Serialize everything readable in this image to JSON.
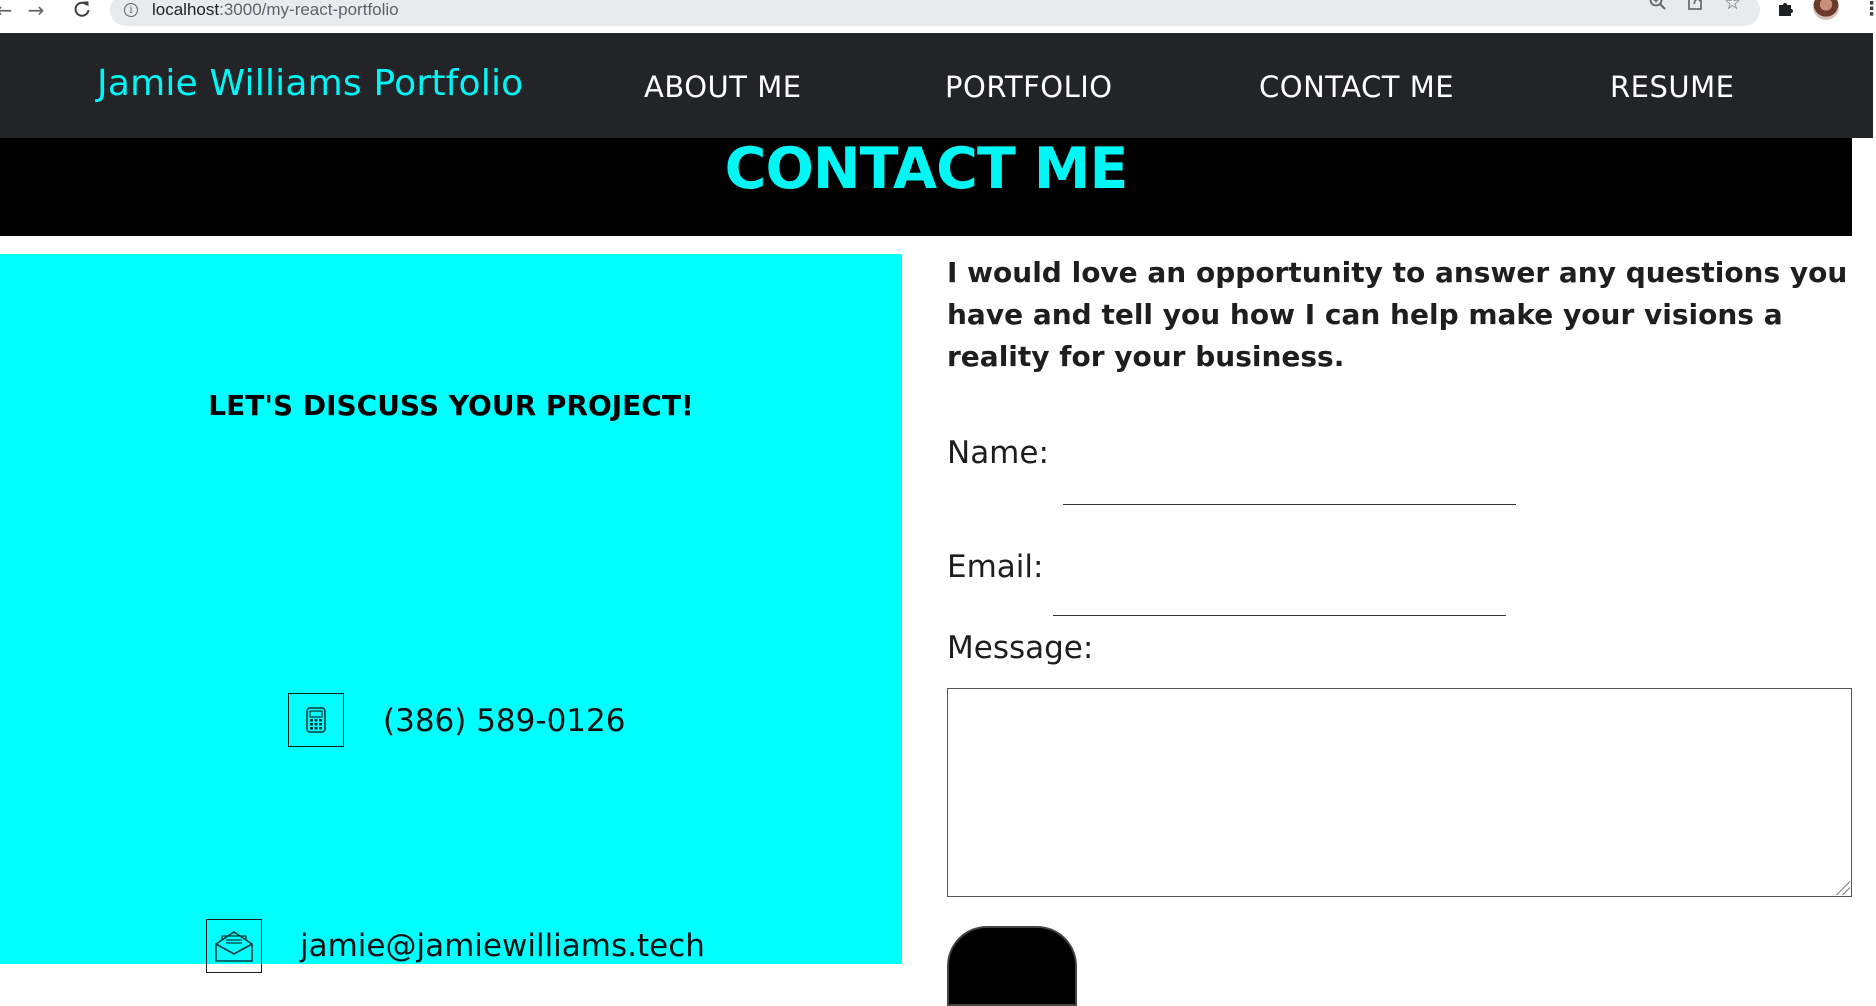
{
  "browser": {
    "url_host": "localhost",
    "url_path": ":3000/my-react-portfolio"
  },
  "header": {
    "brand": "Jamie Williams Portfolio",
    "nav": [
      {
        "label": "ABOUT ME"
      },
      {
        "label": "PORTFOLIO"
      },
      {
        "label": "CONTACT ME"
      },
      {
        "label": "RESUME"
      }
    ]
  },
  "page": {
    "title": "CONTACT ME"
  },
  "contact_panel": {
    "heading": "LET'S DISCUSS YOUR PROJECT!",
    "phone": "(386) 589-0126",
    "email": "jamie@jamiewilliams.tech"
  },
  "form": {
    "intro": "I would love an opportunity to answer any questions you have and tell you how I can help make your visions a reality for your business.",
    "name_label": "Name:",
    "name_value": "",
    "email_label": "Email:",
    "email_value": "",
    "message_label": "Message:",
    "message_value": ""
  },
  "colors": {
    "accent_cyan": "#00f7f5",
    "panel_cyan": "#00ffff",
    "header_bg": "#222428",
    "title_band_bg": "#000000"
  },
  "icons": {
    "back": "arrow-left-icon",
    "forward": "arrow-right-icon",
    "reload": "reload-icon",
    "site_info": "info-icon",
    "zoom": "zoom-icon",
    "share": "share-icon",
    "bookmark": "star-icon",
    "extensions": "puzzle-icon",
    "phone": "calculator-phone-icon",
    "email": "envelope-icon"
  }
}
